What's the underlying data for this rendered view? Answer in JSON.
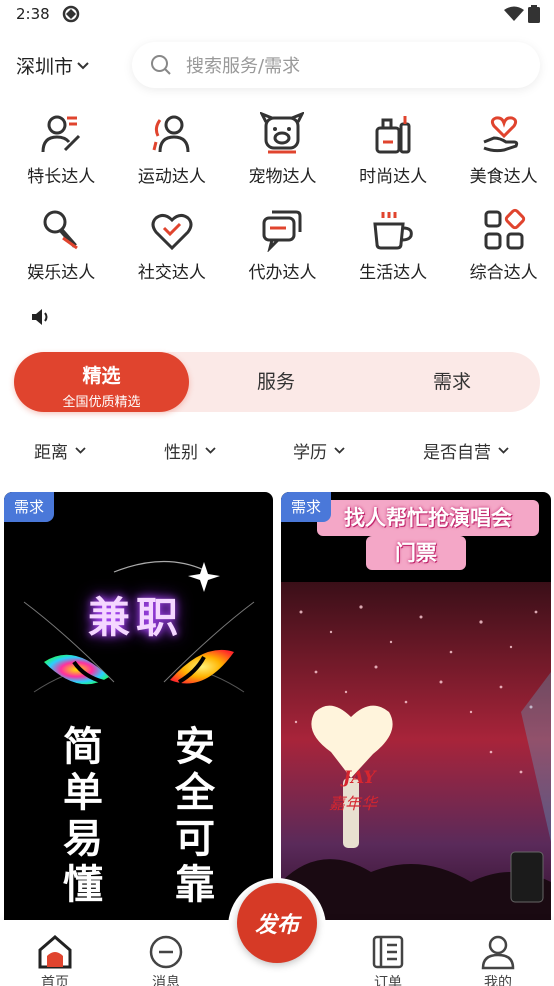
{
  "status_bar": {
    "time": "2:38"
  },
  "header": {
    "city": "深圳市",
    "search_placeholder": "搜索服务/需求"
  },
  "categories": [
    {
      "label": "特长达人",
      "icon": "person-star-icon"
    },
    {
      "label": "运动达人",
      "icon": "person-sport-icon"
    },
    {
      "label": "宠物达人",
      "icon": "pet-icon"
    },
    {
      "label": "时尚达人",
      "icon": "fashion-icon"
    },
    {
      "label": "美食达人",
      "icon": "hand-heart-icon"
    },
    {
      "label": "娱乐达人",
      "icon": "microphone-icon"
    },
    {
      "label": "社交达人",
      "icon": "heart-icon"
    },
    {
      "label": "代办达人",
      "icon": "chat-bubbles-icon"
    },
    {
      "label": "生活达人",
      "icon": "cup-icon"
    },
    {
      "label": "综合达人",
      "icon": "grid-icon"
    }
  ],
  "segment": {
    "active_title": "精选",
    "active_subtitle": "全国优质精选",
    "tabs": [
      "服务",
      "需求"
    ]
  },
  "filters": [
    "距离",
    "性别",
    "学历",
    "是否自营"
  ],
  "cards": [
    {
      "badge": "需求",
      "title": "兼职",
      "left_column": "简单易懂",
      "right_column": "安全可靠"
    },
    {
      "badge": "需求",
      "title_line1": "找人帮忙抢演唱会",
      "title_line2": "门票",
      "lightstick_text": "JAY",
      "lightstick_subtext": "嘉年华"
    }
  ],
  "tabbar": {
    "items": [
      "首页",
      "消息",
      "订单",
      "我的"
    ],
    "publish": "发布"
  },
  "colors": {
    "accent": "#e0442e",
    "badge": "#4a78d9",
    "segment_bg": "#fbe9e7"
  }
}
